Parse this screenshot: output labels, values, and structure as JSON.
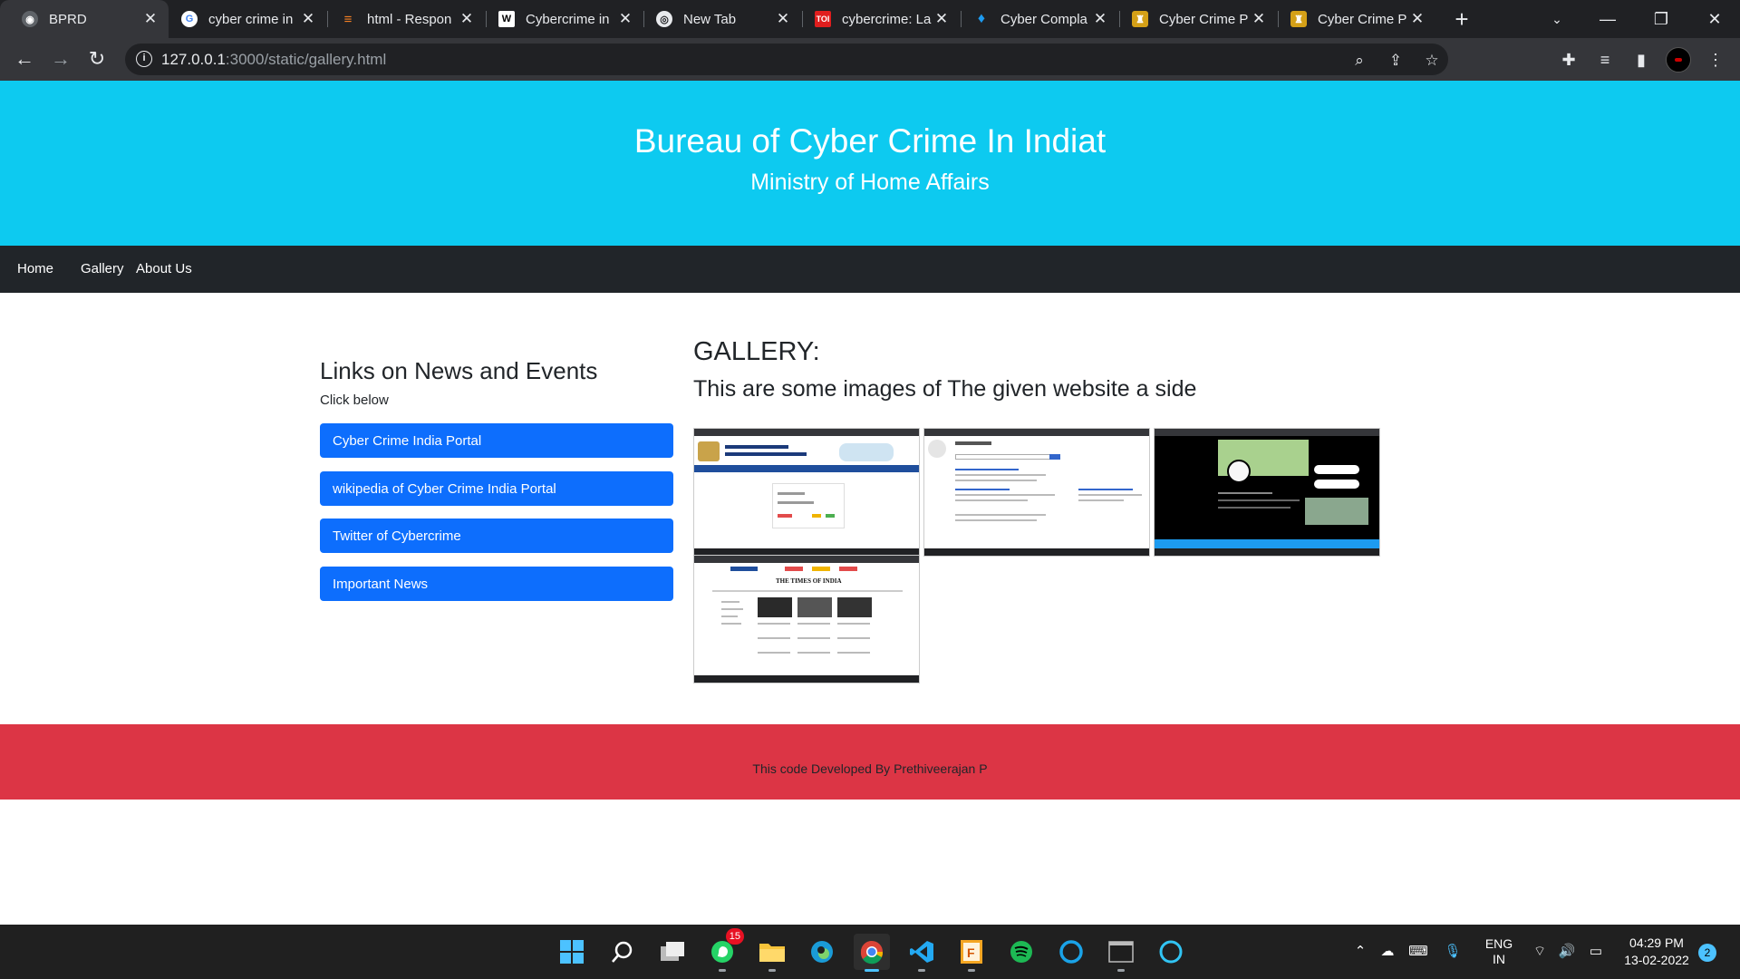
{
  "browser": {
    "tabs": [
      {
        "title": "BPRD",
        "icon": "globe-icon",
        "active": true
      },
      {
        "title": "cyber crime in",
        "icon": "google-icon"
      },
      {
        "title": "html - Respon",
        "icon": "stackoverflow-icon"
      },
      {
        "title": "Cybercrime in",
        "icon": "wikipedia-icon"
      },
      {
        "title": "New Tab",
        "icon": "chrome-icon"
      },
      {
        "title": "cybercrime: La",
        "icon": "toi-icon"
      },
      {
        "title": "Cyber Compla",
        "icon": "twitter-icon"
      },
      {
        "title": "Cyber Crime P",
        "icon": "emblem-icon"
      },
      {
        "title": "Cyber Crime P",
        "icon": "emblem-icon"
      }
    ],
    "url_host": "127.0.0.1",
    "url_rest": ":3000/static/gallery.html"
  },
  "header": {
    "title": "Bureau of Cyber Crime In Indiat",
    "subtitle": "Ministry of Home Affairs",
    "bg_color": "#0dcaf0"
  },
  "nav": {
    "items": [
      "Home",
      "Gallery",
      "About Us"
    ]
  },
  "sidebar": {
    "title": "Links on News and Events",
    "subtitle": "Click below",
    "links": [
      "Cyber Crime India Portal",
      "wikipedia of Cyber Crime India Portal",
      "Twitter of Cybercrime",
      "Important News"
    ],
    "button_color": "#0d6efd"
  },
  "gallery": {
    "title": "GALLERY:",
    "subtitle": "This are some images of The given website a side",
    "thumbnails": [
      "cybercrime-portal-screenshot",
      "wikipedia-screenshot",
      "twitter-screenshot",
      "times-of-india-screenshot"
    ],
    "thumb_caption_4": "THE TIMES OF INDIA"
  },
  "footer": {
    "text": "This code Developed By Prethiveerajan P",
    "bg_color": "#dc3545"
  },
  "taskbar": {
    "whatsapp_badge": "15",
    "lang_top": "ENG",
    "lang_bottom": "IN",
    "time": "04:29 PM",
    "date": "13-02-2022",
    "notifications": "2"
  }
}
